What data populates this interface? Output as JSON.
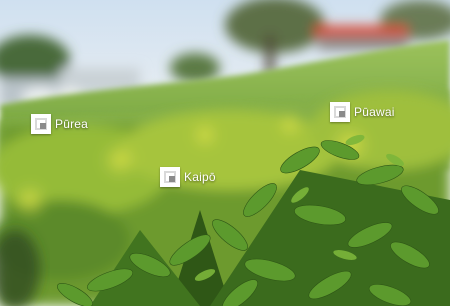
{
  "hotspots": [
    {
      "label": "Pūrea",
      "icon": "hotspot-square-icon"
    },
    {
      "label": "Pūawai",
      "icon": "hotspot-square-icon"
    },
    {
      "label": "Kaipō",
      "icon": "hotspot-square-icon"
    }
  ],
  "colors": {
    "sky": "#dbe8f4",
    "grass": "#7fb24a",
    "foliage_dark": "#3e6b1c",
    "foliage_light": "#b9d24c",
    "roof": "#d9432c",
    "marker_bg": "#ffffff"
  }
}
